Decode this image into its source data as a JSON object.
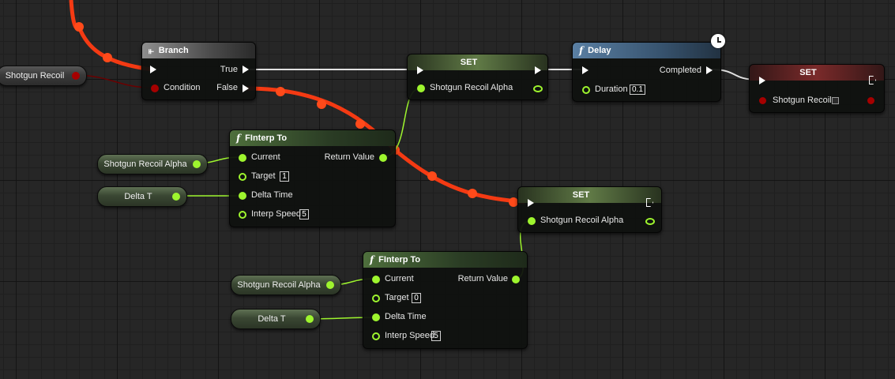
{
  "colors": {
    "float_pin": "#9ef52e",
    "bool_pin": "#a50000",
    "exec_pin": "#ffffff",
    "active_wire": "#ff3b12"
  },
  "nodes": {
    "branch": {
      "title": "Branch",
      "icon": "branch-icon",
      "pins": {
        "true_label": "True",
        "condition_label": "Condition",
        "false_label": "False"
      }
    },
    "set_top": {
      "title": "SET",
      "pin_label": "Shotgun Recoil Alpha"
    },
    "delay": {
      "title": "Delay",
      "icon": "function-icon",
      "completed_label": "Completed",
      "duration_label": "Duration",
      "duration_value": "0.1"
    },
    "set_bool": {
      "title": "SET",
      "pin_label": "Shotgun Recoil"
    },
    "finterp_top": {
      "title": "FInterp To",
      "icon": "function-icon",
      "current_label": "Current",
      "return_label": "Return Value",
      "target_label": "Target",
      "target_value": "1",
      "delta_label": "Delta Time",
      "speed_label": "Interp Speed",
      "speed_value": "5"
    },
    "set_bottom": {
      "title": "SET",
      "pin_label": "Shotgun Recoil Alpha"
    },
    "finterp_bottom": {
      "title": "FInterp To",
      "icon": "function-icon",
      "current_label": "Current",
      "return_label": "Return Value",
      "target_label": "Target",
      "target_value": "0",
      "delta_label": "Delta Time",
      "speed_label": "Interp Speed",
      "speed_value": "5"
    }
  },
  "getters": {
    "shotgun_recoil": "Shotgun Recoil",
    "recoil_alpha_top": "Shotgun Recoil Alpha",
    "delta_t_top": "Delta T",
    "recoil_alpha_bottom": "Shotgun Recoil Alpha",
    "delta_t_bottom": "Delta T"
  }
}
